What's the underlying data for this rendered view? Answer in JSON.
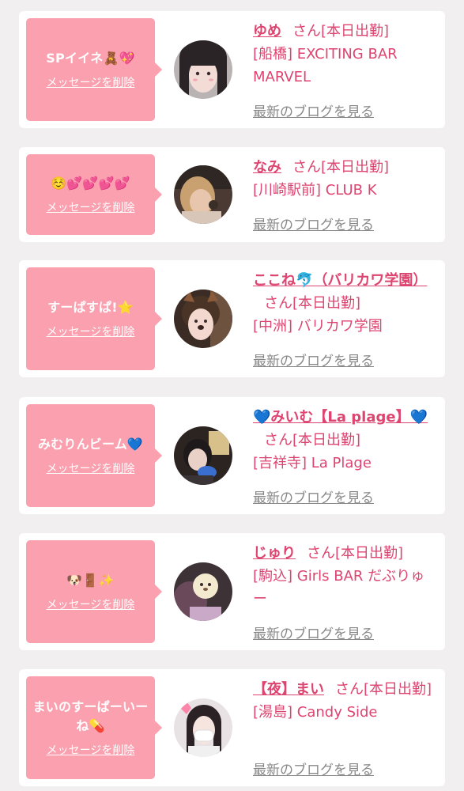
{
  "colors": {
    "background": "#f2eff0",
    "card": "#ffffff",
    "bubble": "#fba0af",
    "accent": "#dd4570",
    "muted": "#888888"
  },
  "delete_label": "メッセージを削除",
  "san_label": "さん",
  "blog_label": "最新のブログを見る",
  "items": [
    {
      "message": "SPイイネ🧸💖",
      "avatar": "girl-photo-avatar",
      "name": "ゆめ",
      "status": "[本日出勤]",
      "shop": "[船橋] EXCITING BAR MARVEL"
    },
    {
      "message": "☺️💕💕💕💕",
      "avatar": "girl-photo-avatar",
      "name": "なみ",
      "status": "[本日出勤]",
      "shop": "[川崎駅前] CLUB K"
    },
    {
      "message": "すーぱすぱ!⭐️",
      "avatar": "girl-photo-avatar",
      "name": "ここね🐬（バリカワ学園）",
      "status": "[本日出勤]",
      "shop": "[中洲] バリカワ学園"
    },
    {
      "message": "みむりんビーム💙",
      "avatar": "girl-photo-avatar",
      "name": "💙みいむ【La plage】💙",
      "status": "[本日出勤]",
      "shop": "[吉祥寺] La Plage"
    },
    {
      "message": "🐶🚪✨",
      "avatar": "girl-photo-avatar",
      "name": "じゅり",
      "status": "[本日出勤]",
      "shop": "[駒込] Girls BAR だぶりゅー"
    },
    {
      "message": "まいのすーぱーいーね💊",
      "avatar": "girl-photo-avatar",
      "name": "【夜】まい",
      "status": "[本日出勤]",
      "shop": "[湯島] Candy Side"
    }
  ]
}
